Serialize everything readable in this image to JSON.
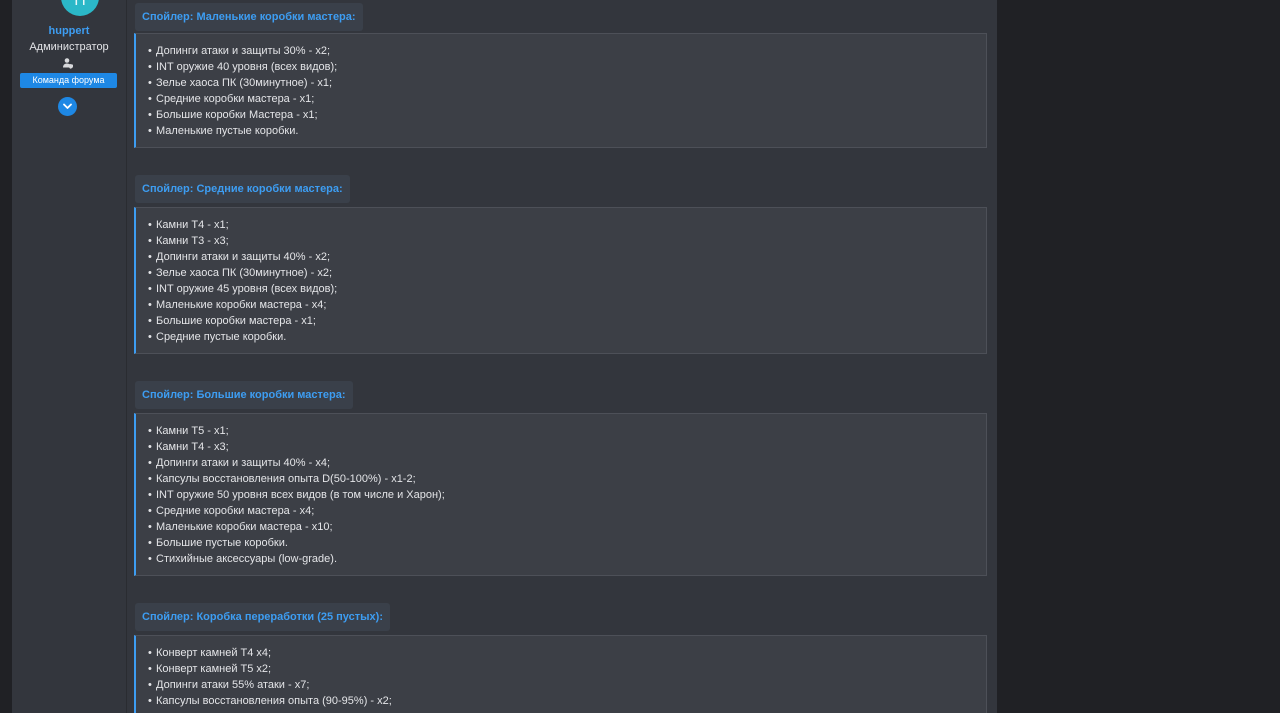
{
  "sidebar": {
    "avatar_letter": "H",
    "username": "huppert",
    "role": "Администратор",
    "team_badge": "Команда форума",
    "user_icon": "user-shield-icon",
    "expand_icon": "chevron-down-icon"
  },
  "spoilers": [
    {
      "title": "Спойлер: Маленькие коробки мастера:",
      "items": [
        "Допинги атаки и защиты 30% - х2;",
        "INT оружие 40 уровня (всех видов);",
        "Зелье хаоса ПК (30минутное) - х1;",
        "Средние коробки мастера - х1;",
        "Большие коробки Мастера - х1;",
        "Маленькие пустые коробки."
      ]
    },
    {
      "title": "Спойлер: Средние коробки мастера:",
      "items": [
        "Камни Т4 - х1;",
        "Камни Т3 - х3;",
        "Допинги атаки и защиты 40% - х2;",
        "Зелье хаоса ПК (30минутное) - х2;",
        "INT оружие 45 уровня (всех видов);",
        "Маленькие коробки мастера - х4;",
        "Большие коробки мастера - х1;",
        "Средние пустые коробки."
      ]
    },
    {
      "title": "Спойлер: Большие коробки мастера:",
      "items": [
        "Камни Т5 - х1;",
        "Камни Т4 - х3;",
        "Допинги атаки и защиты 40% - х4;",
        "Капсулы восстановления опыта D(50-100%) - х1-2;",
        "INT оружие 50 уровня всех видов (в том числе и Харон);",
        "Средние коробки мастера - х4;",
        "Маленькие коробки мастера - х10;",
        "Большие пустые коробки.",
        "Стихийные аксессуары (low-grade)."
      ]
    },
    {
      "title": "Спойлер: Коробка переработки (25 пустых):",
      "items": [
        "Конверт камней Т4 х4;",
        "Конверт камней Т5 х2;",
        "Допинги атаки 55% атаки - х7;",
        "Капсулы восстановления опыта (90-95%) - х2;"
      ]
    }
  ]
}
